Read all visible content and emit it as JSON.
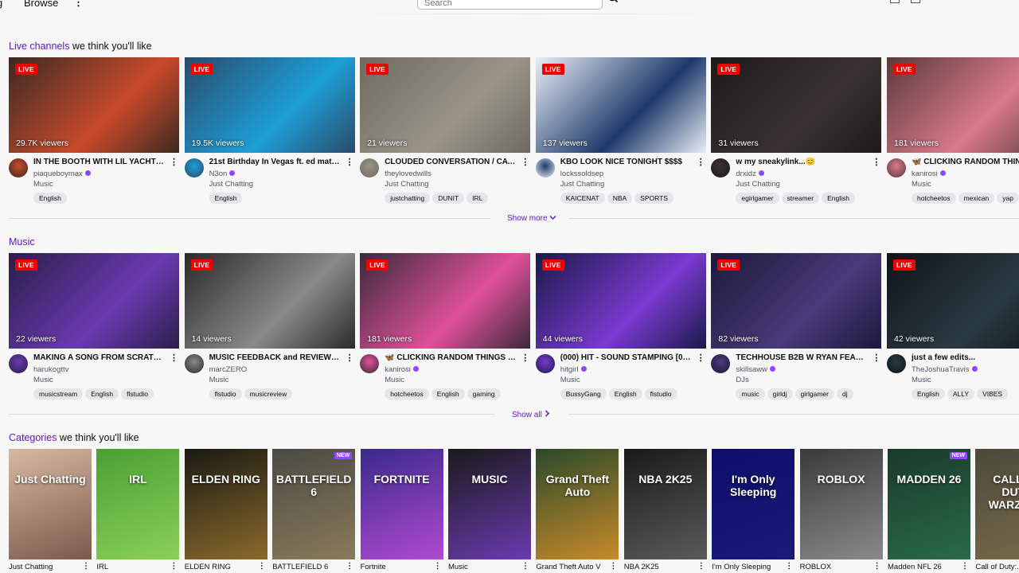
{
  "nav": {
    "partial_left": "g",
    "browse": "Browse",
    "search_placeholder": "Search"
  },
  "live_section": {
    "title_accent": "Live channels",
    "title_rest": " we think you'll like",
    "show_more": "Show more",
    "channels": [
      {
        "title": "IN THE BOOTH WITH LIL YACHTY & ...",
        "user": "piaqueboymax",
        "verified": true,
        "category": "Music",
        "viewers": "29.7K viewers",
        "tags": [
          "English"
        ],
        "bg": "#3a2a22",
        "bg2": "#c94a2a"
      },
      {
        "title": "21st Birthday In Vegas ft. ed matthe...",
        "user": "N3on",
        "verified": true,
        "category": "Just Chatting",
        "viewers": "19.5K viewers",
        "tags": [
          "English"
        ],
        "bg": "#2a4a6a",
        "bg2": "#1d9fd6"
      },
      {
        "title": "CLOUDED CONVERSATION / CATC...",
        "user": "theylovedwills",
        "verified": false,
        "category": "Just Chatting",
        "viewers": "21 viewers",
        "tags": [
          "justchatting",
          "DUNIT",
          "IRL"
        ],
        "bg": "#6e6a62",
        "bg2": "#9a9488"
      },
      {
        "title": "KBO LOOK NICE TONIGHT $$$$",
        "user": "lockssoldsep",
        "verified": false,
        "category": "Just Chatting",
        "viewers": "137 viewers",
        "tags": [
          "KAICENAT",
          "NBA",
          "SPORTS"
        ],
        "bg": "#e8eef6",
        "bg2": "#1e3a6a"
      },
      {
        "title": "w my sneakylink...😊",
        "user": "drxidz",
        "verified": true,
        "category": "Just Chatting",
        "viewers": "31 viewers",
        "tags": [
          "egirlgamer",
          "streamer",
          "English"
        ],
        "bg": "#1e1a1a",
        "bg2": "#3a3232"
      },
      {
        "title": "🦋 CLICKING RANDOM THINGS UN...",
        "user": "kanirosi",
        "verified": true,
        "category": "Music",
        "viewers": "181 viewers",
        "tags": [
          "hotcheetos",
          "mexican",
          "yap"
        ],
        "bg": "#5a3a3a",
        "bg2": "#d87a8a"
      }
    ],
    "live_label": "LIVE"
  },
  "music_section": {
    "title_accent": "Music",
    "show_all": "Show all",
    "channels": [
      {
        "title": "MAKING A SONG FROM SCRATCH I...",
        "user": "harukogttv",
        "verified": false,
        "category": "Music",
        "viewers": "22 viewers",
        "tags": [
          "musicstream",
          "English",
          "flstudio"
        ],
        "bg": "#2a1e4a",
        "bg2": "#6a3ab0"
      },
      {
        "title": "MUSIC FEEDBACK and REVIEW!!! S...",
        "user": "marcZERO",
        "verified": false,
        "category": "Music",
        "viewers": "14 viewers",
        "tags": [
          "flstudio",
          "musicreview"
        ],
        "bg": "#2a2a2a",
        "bg2": "#8a8a8a"
      },
      {
        "title": "🦋 CLICKING RANDOM THINGS UN...",
        "user": "kanirosi",
        "verified": true,
        "category": "Music",
        "viewers": "181 viewers",
        "tags": [
          "hotcheetos",
          "English",
          "gaming"
        ],
        "bg": "#3a2a3a",
        "bg2": "#e0509a"
      },
      {
        "title": "(000) HIT - SOUND STAMPING [00...",
        "user": "hitgirl",
        "verified": true,
        "category": "Music",
        "viewers": "44 viewers",
        "tags": [
          "BussyGang",
          "English",
          "flstudio"
        ],
        "bg": "#1a1a4a",
        "bg2": "#7a3ad0"
      },
      {
        "title": "TECHHOUSE B2B W RYAN FEARON",
        "user": "skillsaww",
        "verified": true,
        "category": "DJs",
        "viewers": "82 viewers",
        "tags": [
          "music",
          "girldj",
          "girlgamer",
          "dj"
        ],
        "bg": "#1a1a3a",
        "bg2": "#4a3a7a"
      },
      {
        "title": "just a few edits...",
        "user": "TheJoshuaTravis",
        "verified": true,
        "category": "Music",
        "viewers": "42 viewers",
        "tags": [
          "English",
          "ALLY",
          "VIBES"
        ],
        "bg": "#101418",
        "bg2": "#2a3a44"
      }
    ]
  },
  "categories_section": {
    "title_accent": "Categories",
    "title_rest": " we think you'll like",
    "new_label": "NEW",
    "items": [
      {
        "name": "Just Chatting",
        "art_text": "Just Chatting",
        "bg": "#d8b9a0",
        "bg2": "#7a5a4a",
        "is_new": false
      },
      {
        "name": "IRL",
        "art_text": "IRL",
        "bg": "#4aa032",
        "bg2": "#8ad05a",
        "is_new": false
      },
      {
        "name": "ELDEN RING",
        "art_text": "ELDEN RING",
        "bg": "#1a1a14",
        "bg2": "#8a6a2a",
        "is_new": false
      },
      {
        "name": "BATTLEFIELD 6",
        "art_text": "BATTLEFIELD 6",
        "bg": "#4a4a44",
        "bg2": "#8a7a5a",
        "is_new": true
      },
      {
        "name": "Fortnite",
        "art_text": "FORTNITE",
        "bg": "#3a2a8a",
        "bg2": "#b04ad0",
        "is_new": false
      },
      {
        "name": "Music",
        "art_text": "MUSIC",
        "bg": "#1a1a1a",
        "bg2": "#6a3ab0",
        "is_new": false
      },
      {
        "name": "Grand Theft Auto V",
        "art_text": "Grand Theft Auto",
        "bg": "#2a4a2a",
        "bg2": "#c88a2a",
        "is_new": false
      },
      {
        "name": "NBA 2K25",
        "art_text": "NBA 2K25",
        "bg": "#1a1a1a",
        "bg2": "#5a5a5a",
        "is_new": false
      },
      {
        "name": "I'm Only Sleeping",
        "art_text": "I'm Only Sleeping",
        "bg": "#0e0e6a",
        "bg2": "#1a1a7a",
        "is_new": false
      },
      {
        "name": "ROBLOX",
        "art_text": "ROBLOX",
        "bg": "#3a3a3a",
        "bg2": "#8a8a8a",
        "is_new": false
      },
      {
        "name": "Madden NFL 26",
        "art_text": "MADDEN 26",
        "bg": "#1a3a2a",
        "bg2": "#2a6a4a",
        "is_new": true
      },
      {
        "name": "Call of Duty:...",
        "art_text": "CALL OF DUTY WARZONE",
        "bg": "#4a4a3a",
        "bg2": "#7a6a4a",
        "is_new": false
      }
    ]
  }
}
